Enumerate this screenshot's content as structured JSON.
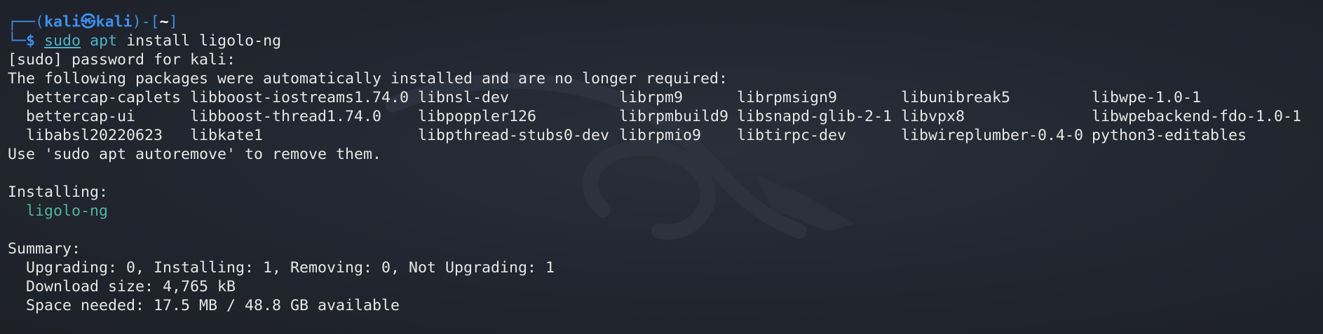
{
  "prompt": {
    "frame_top_left": "┌──(",
    "user": "kali",
    "at_symbol": "㉿",
    "host": "kali",
    "frame_mid": ")-[",
    "cwd": "~",
    "frame_end": "]",
    "frame_bottom": "└─",
    "dollar": "$",
    "sudo": "sudo",
    "apt": "apt",
    "args": "install ligolo-ng"
  },
  "output": {
    "sudo_prompt": "[sudo] password for kali:",
    "auto_installed_notice": "The following packages were automatically installed and are no longer required:",
    "packages": [
      "bettercap-caplets",
      "libboost-iostreams1.74.0",
      "libnsl-dev",
      "librpm9",
      "librpmsign9",
      "libunibreak5",
      "libwpe-1.0-1",
      "bettercap-ui",
      "libboost-thread1.74.0",
      "libpoppler126",
      "librpmbuild9",
      "libsnapd-glib-2-1",
      "libvpx8",
      "libwpebackend-fdo-1.0-1",
      "libabsl20220623",
      "libkate1",
      "libpthread-stubs0-dev",
      "librpmio9",
      "libtirpc-dev",
      "libwireplumber-0.4-0",
      "python3-editables"
    ],
    "autoremove_hint": "Use 'sudo apt autoremove' to remove them.",
    "installing_header": "Installing:",
    "installing_package": "ligolo-ng",
    "summary_header": "Summary:",
    "summary_counts": "Upgrading: 0, Installing: 1, Removing: 0, Not Upgrading: 1",
    "download_size": "Download size: 4,765 kB",
    "space_needed": "Space needed: 17.5 MB / 48.8 GB available"
  }
}
